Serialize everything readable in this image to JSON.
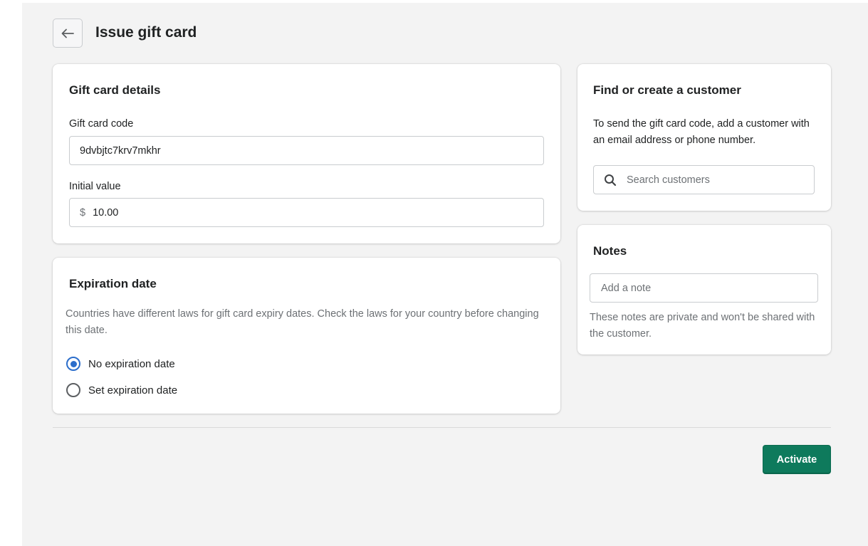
{
  "header": {
    "back_icon": "arrow-left-icon",
    "title": "Issue gift card"
  },
  "gift_card_details": {
    "title": "Gift card details",
    "code_label": "Gift card code",
    "code_value": "9dvbjtc7krv7mkhr",
    "value_label": "Initial value",
    "currency_symbol": "$",
    "value_amount": "10.00"
  },
  "expiration": {
    "title": "Expiration date",
    "help_text": "Countries have different laws for gift card expiry dates. Check the laws for your country before changing this date.",
    "options": [
      {
        "label": "No expiration date",
        "selected": true
      },
      {
        "label": "Set expiration date",
        "selected": false
      }
    ]
  },
  "customer": {
    "title": "Find or create a customer",
    "help_text": "To send the gift card code, add a customer with an email address or phone number.",
    "search_icon": "search-icon",
    "search_placeholder": "Search customers"
  },
  "notes": {
    "title": "Notes",
    "placeholder": "Add a note",
    "help_text": "These notes are private and won't be shared with the customer."
  },
  "footer": {
    "activate_label": "Activate"
  },
  "colors": {
    "primary_button": "#0e7a5c",
    "radio_selected": "#2c6ecb",
    "page_background": "#f3f3f3"
  }
}
